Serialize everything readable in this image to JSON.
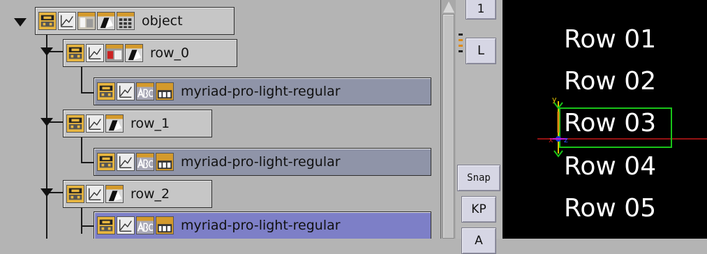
{
  "tree": {
    "nodes": [
      {
        "label": "object",
        "kind": "container"
      },
      {
        "label": "row_0",
        "kind": "container"
      },
      {
        "label": "myriad-pro-light-regular",
        "kind": "text"
      },
      {
        "label": "row_1",
        "kind": "container"
      },
      {
        "label": "myriad-pro-light-regular",
        "kind": "text"
      },
      {
        "label": "row_2",
        "kind": "container"
      },
      {
        "label": "myriad-pro-light-regular",
        "kind": "text",
        "selected": true
      }
    ],
    "icon_names": [
      "transform-icon",
      "alpha-icon",
      "container-icon",
      "surface-icon",
      "grid-icon",
      "text-icon",
      "textfx-icon",
      "cam-icon"
    ]
  },
  "toolbar": {
    "btn_top": "1",
    "btn_layout": "L",
    "btn_snap": "Snap",
    "btn_kp": "KP",
    "btn_partial": "A"
  },
  "viewport": {
    "rows": [
      "Row 01",
      "Row 02",
      "Row 03",
      "Row 04",
      "Row 05"
    ],
    "selected_row": "Row 03",
    "gizmo_y_label": "y",
    "gizmo_x_label": "x",
    "gizmo_z_label": "z",
    "colors": {
      "background": "#000000",
      "text": "#ffffff",
      "bbox": "#19c419",
      "axis_x": "#c41818",
      "axis_y": "#e0c000"
    }
  }
}
